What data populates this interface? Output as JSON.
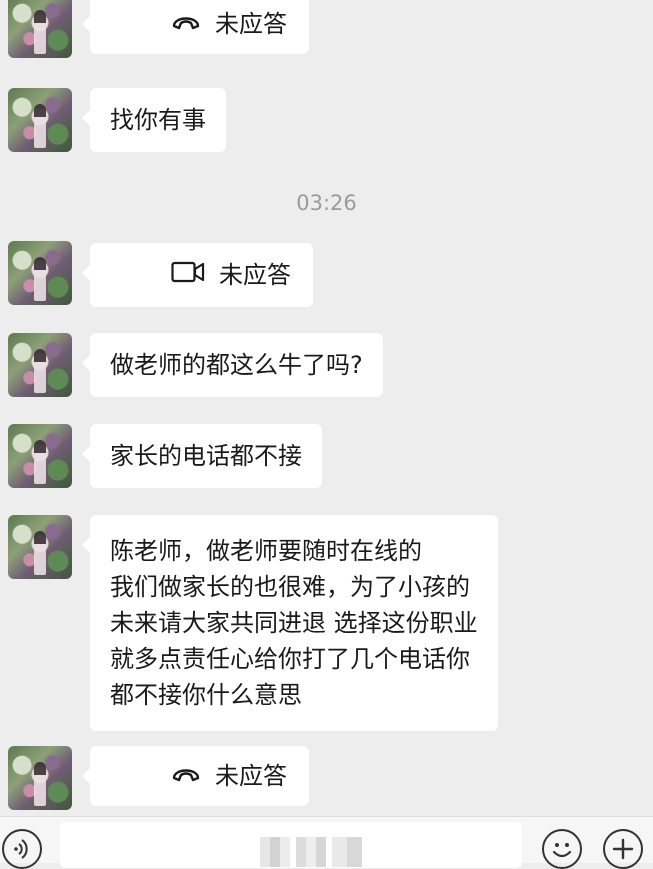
{
  "chat": {
    "timestamp": "03:26",
    "messages": [
      {
        "type": "voice-call",
        "icon": "phone-hangup-icon",
        "label": "未应答"
      },
      {
        "type": "text",
        "text": "找你有事"
      },
      {
        "type": "video-call",
        "icon": "video-camera-icon",
        "label": "未应答"
      },
      {
        "type": "text",
        "text": "做老师的都这么牛了吗?"
      },
      {
        "type": "text",
        "text": "家长的电话都不接"
      },
      {
        "type": "text",
        "text": "陈老师，做老师要随时在线的\n我们做家长的也很难，为了小孩的\n未来请大家共同进退 选择这份职业\n就多点责任心给你打了几个电话你\n都不接你什么意思"
      },
      {
        "type": "voice-call",
        "icon": "phone-hangup-icon",
        "label": "未应答"
      }
    ]
  },
  "input_bar": {
    "icons": {
      "voice": "voice-input-icon",
      "emoji": "emoji-icon",
      "more": "plus-icon"
    }
  }
}
